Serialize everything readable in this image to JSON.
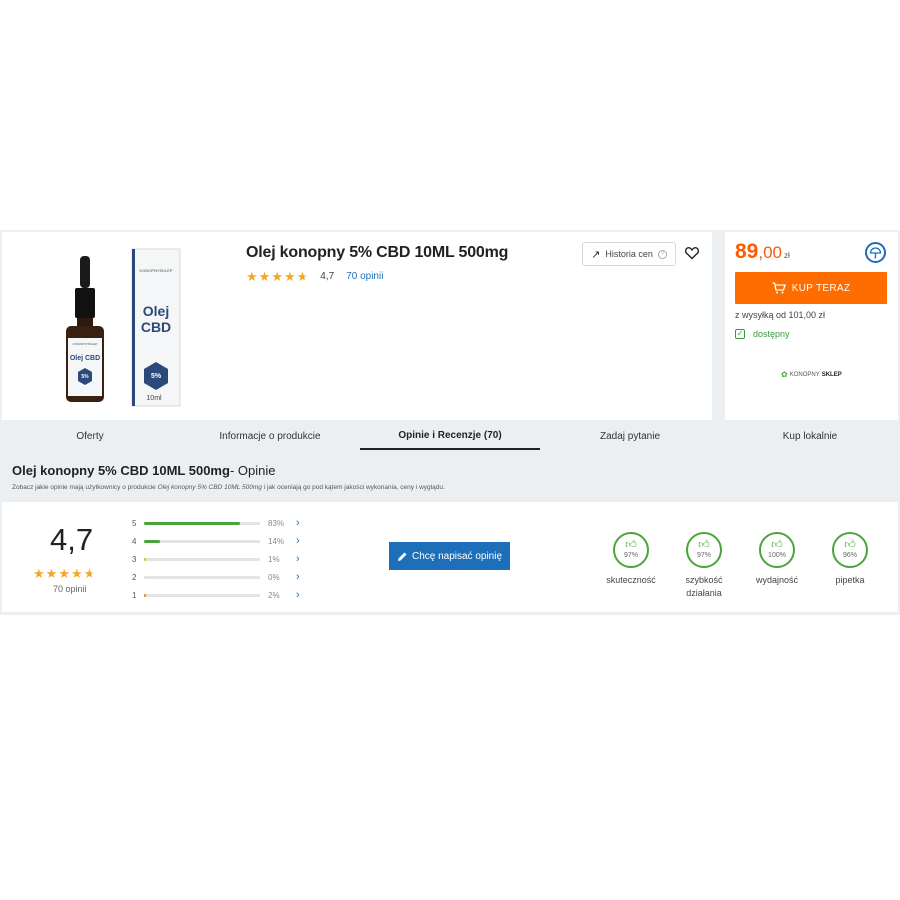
{
  "product": {
    "title": "Olej konopny 5% CBD 10ML 500mg",
    "rating_value": "4,7",
    "reviews_link": "70 opinii",
    "history_label": "Historia cen",
    "history_help": "?",
    "image_texts": {
      "box_brand": "KONOPNYSKLEP",
      "box_line1": "Olej",
      "box_line2": "CBD",
      "box_percent": "5%",
      "box_volume": "10ml",
      "bottle_brand": "KONOPNYSKLEP",
      "bottle_line": "Olej CBD",
      "bottle_percent": "5%"
    }
  },
  "offer": {
    "price_int": "89",
    "price_dec": ",00",
    "currency": "zł",
    "buy_label": "KUP TERAZ",
    "shipping": "z wysyłką od 101,00 zł",
    "availability": "dostępny",
    "shop_logo_a": "KONOPNY",
    "shop_logo_b": "SKLEP"
  },
  "tabs": [
    {
      "label": "Oferty"
    },
    {
      "label": "Informacje o produkcie"
    },
    {
      "label": "Opinie i Recenzje (70)"
    },
    {
      "label": "Zadaj pytanie"
    },
    {
      "label": "Kup lokalnie"
    }
  ],
  "reviews": {
    "heading_bold": "Olej konopny 5% CBD 10ML 500mg",
    "heading_rest": "- Opinie",
    "subtitle_a": "Zobacz jakie opinie mają użytkownicy o produkcie ",
    "subtitle_product": "Olej konopny 5% CBD 10ML 500mg",
    "subtitle_b": " i jak oceniają go pod kątem jakości wykonania, ceny i wyglądu.",
    "average": "4,7",
    "count": "70 opinii",
    "distribution": [
      {
        "stars": "5",
        "pct_label": "83%",
        "fraction": 0.83,
        "color": "#4aa63a"
      },
      {
        "stars": "4",
        "pct_label": "14%",
        "fraction": 0.14,
        "color": "#4aa63a"
      },
      {
        "stars": "3",
        "pct_label": "1%",
        "fraction": 0.01,
        "color": "#f0c000"
      },
      {
        "stars": "2",
        "pct_label": "0%",
        "fraction": 0.0,
        "color": "#f08a00"
      },
      {
        "stars": "1",
        "pct_label": "2%",
        "fraction": 0.02,
        "color": "#f08a00"
      }
    ],
    "write_label": "Chcę napisać opinię",
    "attributes": [
      {
        "pct": "97%",
        "label_1": "skuteczność",
        "label_2": ""
      },
      {
        "pct": "97%",
        "label_1": "szybkość",
        "label_2": "działania"
      },
      {
        "pct": "100%",
        "label_1": "wydajność",
        "label_2": ""
      },
      {
        "pct": "96%",
        "label_1": "pipetka",
        "label_2": ""
      }
    ]
  },
  "colors": {
    "price": "#ff5a00",
    "buy_button": "#ff6d00",
    "write_button": "#1c6fb8",
    "positive": "#4aa63a",
    "star": "#f5a623"
  }
}
